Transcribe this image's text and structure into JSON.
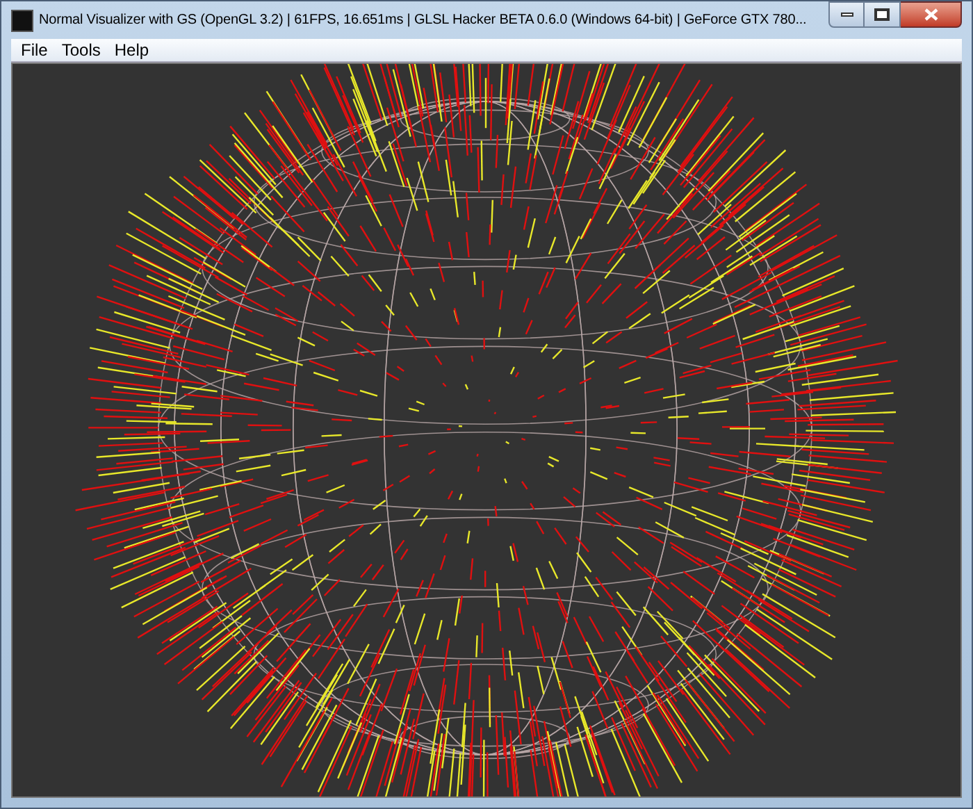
{
  "window": {
    "title": "Normal Visualizer with GS (OpenGL 3.2) | 61FPS, 16.651ms | GLSL Hacker BETA 0.6.0 (Windows 64-bit) | GeForce GTX 780..."
  },
  "menu": [
    "File",
    "Tools",
    "Help"
  ]
}
